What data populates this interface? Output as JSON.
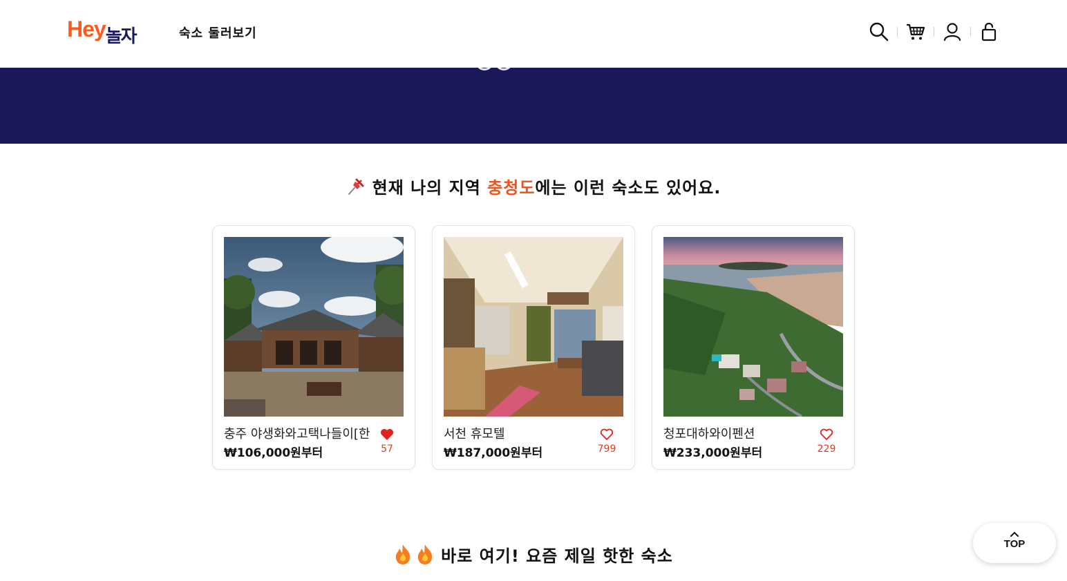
{
  "header": {
    "logo_hey": "Hey",
    "logo_nolja": "놀자",
    "nav_browse": "숙소 둘러보기",
    "icons": [
      "search-icon",
      "cart-icon",
      "user-icon",
      "lock-icon"
    ]
  },
  "region_section": {
    "title_prefix": "현재 나의 지역 ",
    "region": "충청도",
    "title_suffix": "에는 이런 숙소도 있어요.",
    "accent_color": "#f0521c"
  },
  "cards": [
    {
      "name": "충주 야생화와고택나들이[한",
      "price": "₩106,000원부터",
      "likes": "57",
      "liked": true
    },
    {
      "name": "서천 휴모텔",
      "price": "₩187,000원부터",
      "likes": "799",
      "liked": false
    },
    {
      "name": "청포대하와이펜션",
      "price": "₩233,000원부터",
      "likes": "229",
      "liked": false
    }
  ],
  "hot_section": {
    "title": "바로 여기! 요즘 제일 핫한 숙소"
  },
  "top_button": {
    "label": "TOP"
  },
  "colors": {
    "brand_orange": "#ff5a1f",
    "brand_navy": "#1b185a",
    "heart_red": "#e0391f"
  }
}
